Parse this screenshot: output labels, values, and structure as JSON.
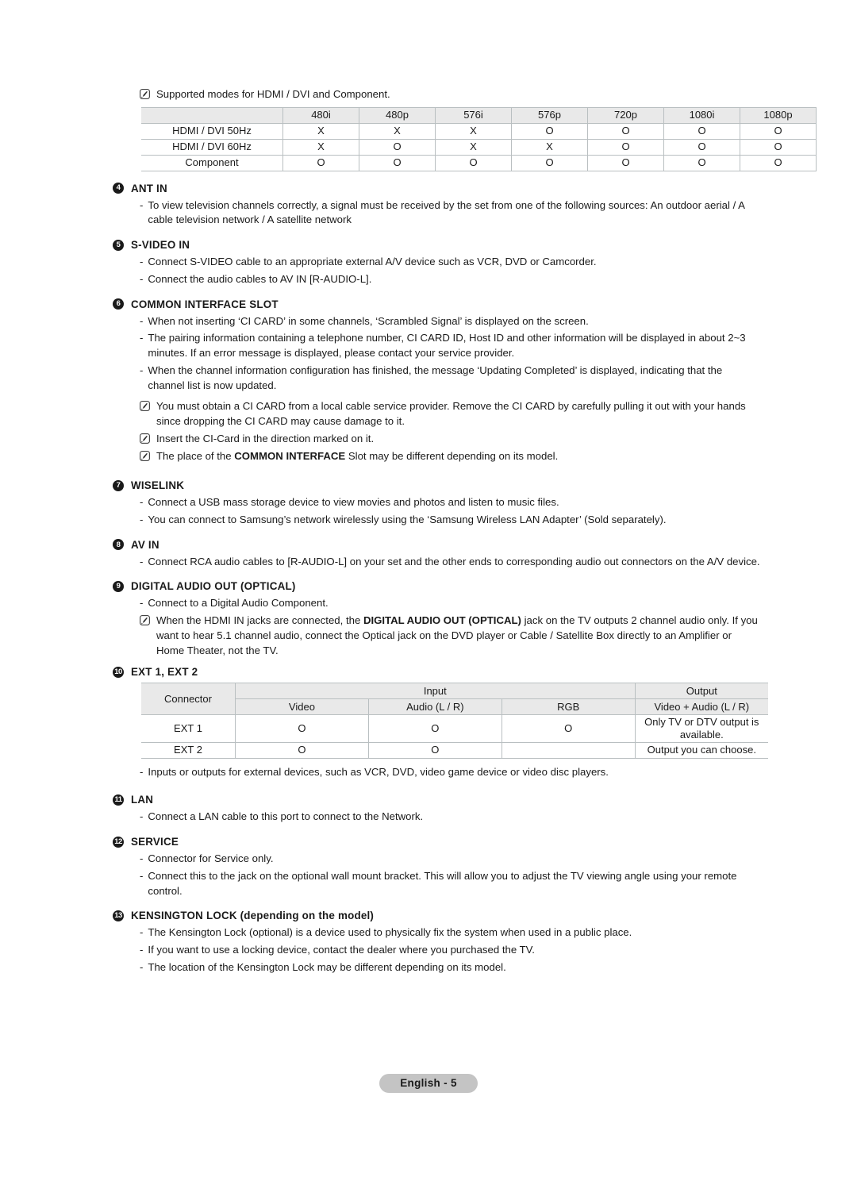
{
  "document": {
    "note_icon_name": "note-pencil-icon",
    "footer_page_label": "English - 5"
  },
  "intro_note": "Supported modes for HDMI / DVI and Component.",
  "modes_table": {
    "columns": [
      "480i",
      "480p",
      "576i",
      "576p",
      "720p",
      "1080i",
      "1080p"
    ],
    "rows": [
      {
        "label": "HDMI / DVI 50Hz",
        "values": [
          "X",
          "X",
          "X",
          "O",
          "O",
          "O",
          "O"
        ]
      },
      {
        "label": "HDMI / DVI 60Hz",
        "values": [
          "X",
          "O",
          "X",
          "X",
          "O",
          "O",
          "O"
        ]
      },
      {
        "label": "Component",
        "values": [
          "O",
          "O",
          "O",
          "O",
          "O",
          "O",
          "O"
        ]
      }
    ]
  },
  "sections": [
    {
      "number": "4",
      "title": "ANT IN",
      "bullets": [
        "To view television channels correctly, a signal must be received by the set from one of the following sources: An outdoor aerial / A cable television network / A satellite network"
      ]
    },
    {
      "number": "5",
      "title": "S-VIDEO IN",
      "bullets": [
        "Connect S-VIDEO cable to an appropriate external A/V device such as VCR, DVD or Camcorder.",
        "Connect the audio cables to AV IN [R-AUDIO-L]."
      ]
    },
    {
      "number": "6",
      "title": "COMMON INTERFACE SLOT",
      "bullets": [
        "When not inserting ‘CI CARD’ in some channels, ‘Scrambled Signal’ is displayed on the screen.",
        "The pairing information containing a telephone number, CI CARD ID, Host ID and other information will be displayed in about 2~3 minutes. If an error message is displayed, please contact your service provider.",
        "When the channel information configuration has finished, the message ‘Updating Completed’ is displayed, indicating that the channel list is now updated."
      ],
      "notes": [
        "You must obtain a CI CARD from a local cable service provider. Remove the CI CARD by carefully pulling it out with your hands since dropping the CI CARD may cause damage to it.",
        "Insert the CI-Card in the direction marked on it.",
        "The place of the COMMON INTERFACE Slot may be different depending on its model."
      ]
    },
    {
      "number": "7",
      "title": "WISELINK",
      "bullets": [
        "Connect a USB mass storage device to view movies and photos and listen to music files.",
        "You can connect to Samsung’s network wirelessly using the ‘Samsung Wireless LAN Adapter’ (Sold separately)."
      ]
    },
    {
      "number": "8",
      "title": "AV IN",
      "bullets": [
        "Connect RCA audio cables to [R-AUDIO-L] on your set and the other ends to corresponding audio out connectors on the A/V device."
      ]
    },
    {
      "number": "9",
      "title": "DIGITAL AUDIO OUT (OPTICAL)",
      "bullets": [
        "Connect to a Digital Audio Component."
      ],
      "notes": [
        "When the HDMI IN jacks are connected, the DIGITAL AUDIO OUT (OPTICAL) jack on the TV outputs 2 channel audio only. If you want to hear 5.1 channel audio, connect the Optical jack on the DVD player or Cable / Satellite Box directly to an Amplifier or Home Theater, not the TV."
      ]
    },
    {
      "number": "10",
      "title": "EXT 1, EXT 2",
      "bullets_after_table": [
        "Inputs or outputs for external devices, such as VCR, DVD, video game device or video disc players."
      ]
    },
    {
      "number": "11",
      "title": "LAN",
      "bullets": [
        "Connect a LAN cable to this port to connect to the Network."
      ]
    },
    {
      "number": "12",
      "title": "SERVICE",
      "bullets": [
        "Connector for Service only.",
        "Connect this to the jack on the optional wall mount bracket. This will allow you to adjust the TV viewing angle using your remote control."
      ]
    },
    {
      "number": "13",
      "title": "KENSINGTON LOCK (depending on the model)",
      "bullets": [
        "The Kensington Lock (optional) is a device used to physically fix the system when used in a public place.",
        "If you want to use a locking device, contact the dealer where you purchased the TV.",
        "The location of the Kensington Lock may be different depending on its model."
      ]
    }
  ],
  "ext_table": {
    "connector_header": "Connector",
    "input_header": "Input",
    "output_header": "Output",
    "sub_headers": [
      "Video",
      "Audio (L / R)",
      "RGB"
    ],
    "output_sub_header": "Video + Audio (L / R)",
    "rows": [
      {
        "label": "EXT 1",
        "video": "O",
        "audio": "O",
        "rgb": "O",
        "output": "Only TV or DTV output is available."
      },
      {
        "label": "EXT 2",
        "video": "O",
        "audio": "O",
        "rgb": "",
        "output": "Output you can choose."
      }
    ]
  },
  "colors": {
    "table_header_bg": "#e9e9e9",
    "table_border": "#b9bfc1",
    "page_pill_bg": "#c4c4c4",
    "text": "#1a1a1a"
  }
}
